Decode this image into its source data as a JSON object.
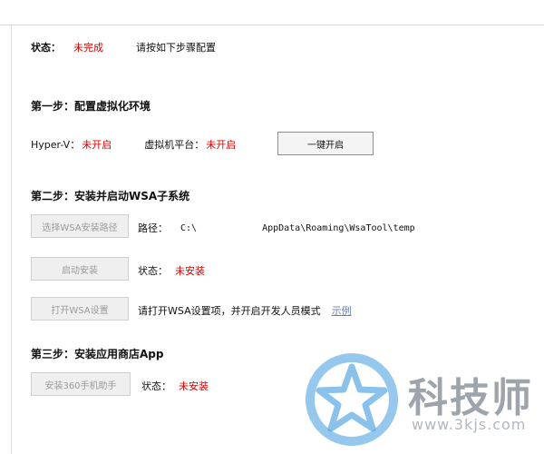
{
  "status": {
    "label": "状态：",
    "value": "未完成",
    "hint": "请按如下步骤配置"
  },
  "step1": {
    "title": "第一步：配置虚拟化环境",
    "hyperv_label": "Hyper-V：",
    "hyperv_value": "未开启",
    "platform_label": "虚拟机平台：",
    "platform_value": "未开启",
    "enable_button": "一键开启"
  },
  "step2": {
    "title": "第二步：安装并启动WSA子系统",
    "choose_path_button": "选择WSA安装路径",
    "path_label": "路径：",
    "path_prefix": "C:\\",
    "path_suffix": "AppData\\Roaming\\WsaTool\\temp",
    "start_install_button": "启动安装",
    "install_status_label": "状态：",
    "install_status_value": "未安装",
    "open_settings_button": "打开WSA设置",
    "settings_hint": "请打开WSA设置项，并开启开发人员模式",
    "example_link": "示例"
  },
  "step3": {
    "title": "第三步：安装应用商店App",
    "install_assistant_button": "安装360手机助手",
    "status_label": "状态：",
    "status_value": "未安装"
  },
  "watermark": {
    "text": "科技师",
    "url": "www.3kjs.com"
  },
  "colors": {
    "red": "#d40000",
    "link": "#6e7fb6",
    "watermark": "#9ea4ab",
    "star_blue": "#3f9ae0"
  }
}
